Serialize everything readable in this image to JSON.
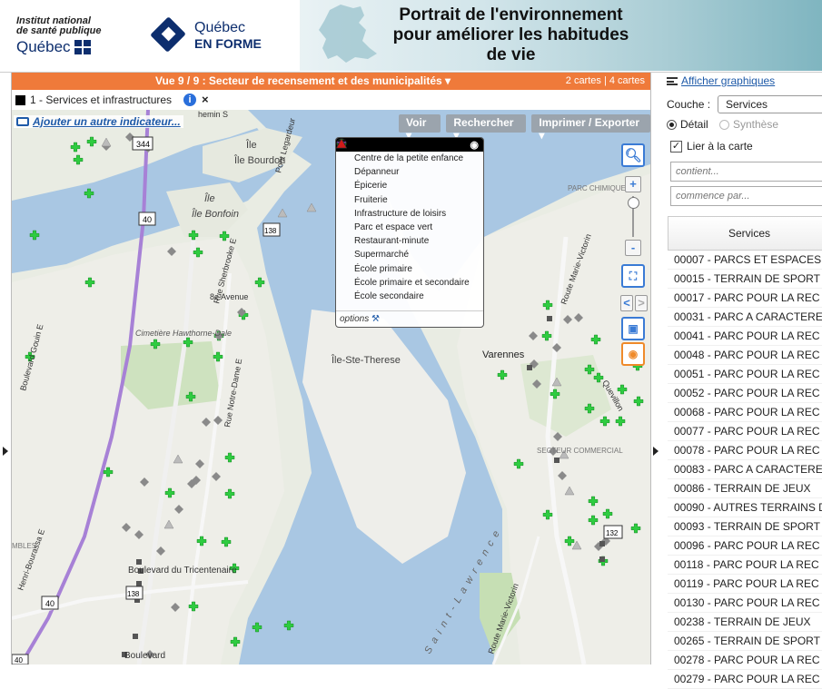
{
  "header": {
    "inspq_line1": "Institut national",
    "inspq_line2": "de santé publique",
    "inspq_quebec": "Québec",
    "qef_line1": "Québec",
    "qef_line2": "EN FORME",
    "title_line1": "Portrait de l'environnement",
    "title_line2": "pour améliorer les habitudes",
    "title_line3": "de vie"
  },
  "map_panel": {
    "vue_title": "Vue 9 / 9 : Secteur de recensement et des municipalités",
    "vue_dropdown_icon": "caret-down-icon",
    "counts": "2 cartes  | 4 cartes",
    "layer_name": "1 - Services et infrastructures",
    "add_indicator": "Ajouter un autre indicateur...",
    "toolbar": [
      "Voir",
      "Rechercher",
      "Imprimer / Exporter"
    ],
    "legend": {
      "title": "1",
      "items": [
        {
          "label": "Centre de la petite enfance",
          "symbol": "circle",
          "color": "#ffffff"
        },
        {
          "label": "Dépanneur",
          "symbol": "diamond",
          "color": "#1b2fd0"
        },
        {
          "label": "Épicerie",
          "symbol": "diamond",
          "color": "#d01b1b"
        },
        {
          "label": "Fruiterie",
          "symbol": "diamond",
          "color": "#27c22c"
        },
        {
          "label": "Infrastructure de loisirs",
          "symbol": "cross",
          "color": "#d01b1b"
        },
        {
          "label": "Parc et espace vert",
          "symbol": "cross",
          "color": "#27c22c"
        },
        {
          "label": "Restaurant-minute",
          "symbol": "square",
          "color": "#111111"
        },
        {
          "label": "Supermarché",
          "symbol": "star",
          "color": "#8a3cc4"
        },
        {
          "label": "École primaire",
          "symbol": "triangle",
          "color": "#f2c21b"
        },
        {
          "label": "École primaire et secondaire",
          "symbol": "triangle",
          "color": "#1b2fd0"
        },
        {
          "label": "École secondaire",
          "symbol": "triangle",
          "color": "#d01b1b"
        }
      ],
      "options": "options"
    },
    "map_labels": {
      "ile_bourdon": "Île Bourdon",
      "ile_bonfoin": "Île Bonfoin",
      "ile_ste_therese": "Île-Ste-Therese",
      "varennes": "Varennes",
      "cimetiere": "Cimetière Hawthorne-Dale",
      "secteur_commercial": "SECTEUR COMMERCIAL",
      "parc_chimique": "PARC CHIMIQUE",
      "rue_sherbrooke": "Rue Sherbrooke E",
      "boulevard_tricentenaire": "Boulevard du Tricentenaire",
      "boulevard": "Boulevard",
      "boulevard_gouin": "Boulevard Gouin E",
      "henri_bourassa": "Henri-Bourassa E",
      "avenue_8": "8e Avenue",
      "notre_dame": "Rue Notre-Dame E",
      "route_marie_victorin": "Route Marie-Victorin",
      "marie_victorin": "Route Marie-Victorin",
      "quevillon": "Quevillon",
      "st_laurence": "Saint-Lawrence",
      "pont_legardeur": "Pont Legardeur",
      "mbles": "MBLES",
      "chemin": "hemin S",
      "hwy40a": "40",
      "hwy40b": "40",
      "hwy40c": "40",
      "hwy344": "344",
      "hwy138a": "138",
      "hwy138b": "138",
      "hwy132": "132"
    }
  },
  "right_panel": {
    "graph_link": "Afficher graphiques",
    "couche_label": "Couche :",
    "couche_value": "Services",
    "detail": "Détail",
    "synthese": "Synthèse",
    "lier": "Lier à la carte",
    "contient_placeholder": "contient...",
    "commence_placeholder": "commence par...",
    "list_header": "Services",
    "rows": [
      "00007 - PARCS ET ESPACES",
      "00015 - TERRAIN DE SPORT",
      "00017 - PARC POUR LA REC",
      "00031 - PARC A CARACTERE",
      "00041 - PARC POUR LA REC",
      "00048 - PARC POUR LA REC",
      "00051 - PARC POUR LA REC",
      "00052 - PARC POUR LA REC",
      "00068 - PARC POUR LA REC",
      "00077 - PARC POUR LA REC",
      "00078 - PARC POUR LA REC",
      "00083 - PARC A CARACTERE",
      "00086 - TERRAIN DE JEUX",
      "00090 - AUTRES TERRAINS D",
      "00093 - TERRAIN DE SPORT",
      "00096 - PARC POUR LA REC",
      "00118 - PARC POUR LA REC",
      "00119 - PARC POUR LA REC",
      "00130 - PARC POUR LA REC",
      "00238 - TERRAIN DE JEUX",
      "00265 - TERRAIN DE SPORT",
      "00278 - PARC POUR LA REC",
      "00279 - PARC POUR LA REC"
    ]
  }
}
